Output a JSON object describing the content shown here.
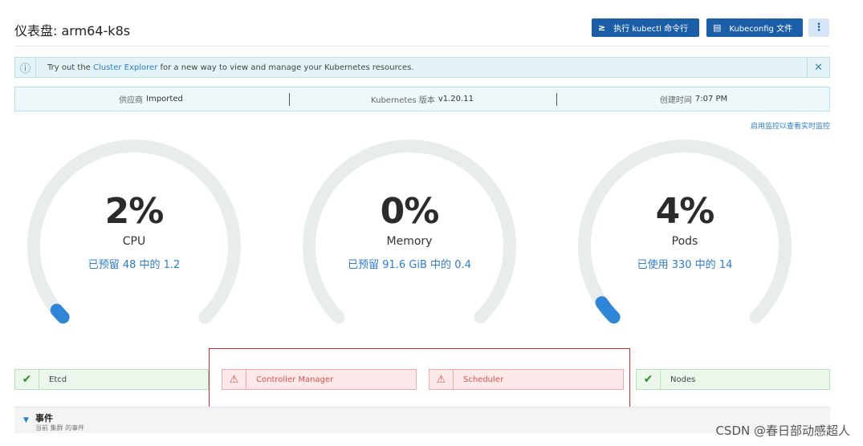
{
  "header": {
    "title": "仪表盘: arm64-k8s",
    "kubectl_icon": "≥",
    "kubectl_label": "执行 kubectl 命令行",
    "kubeconfig_icon": "▤",
    "kubeconfig_label": "Kubeconfig 文件",
    "more_label": "⋮"
  },
  "banner": {
    "icon": "ⓘ",
    "text_before": "Try out the ",
    "link": "Cluster Explorer",
    "text_after": " for a new way to view and manage your Kubernetes resources.",
    "close": "✕"
  },
  "info": {
    "provider_label": "供应商",
    "provider_value": "Imported",
    "k8s_label": "Kubernetes 版本",
    "k8s_value": "v1.20.11",
    "created_label": "创建时间",
    "created_value": "7:07 PM"
  },
  "monitoring_link": "启用监控以查看实时监控",
  "gauges": [
    {
      "percent": "2%",
      "label": "CPU",
      "detail": "已预留 48 中的 1.2",
      "value": 0.02
    },
    {
      "percent": "0%",
      "label": "Memory",
      "detail": "已预留 91.6 GiB 中的 0.4",
      "value": 0.0
    },
    {
      "percent": "4%",
      "label": "Pods",
      "detail": "已使用 330 中的 14",
      "value": 0.04
    }
  ],
  "components": [
    {
      "name": "Etcd",
      "status": "ok"
    },
    {
      "name": "Controller Manager",
      "status": "error"
    },
    {
      "name": "Scheduler",
      "status": "error"
    },
    {
      "name": "Nodes",
      "status": "ok"
    }
  ],
  "events": {
    "caret": "▼",
    "title": "事件",
    "description": "当前 集群 的事件"
  },
  "watermark": "CSDN @春日部动感超人",
  "colors": {
    "primary": "#1b5ea8",
    "link": "#2d7dc8",
    "gauge_track": "#e9eced",
    "gauge_fill": "#2f86d6",
    "ok": "#2f8f2f",
    "error": "#d9534f"
  }
}
